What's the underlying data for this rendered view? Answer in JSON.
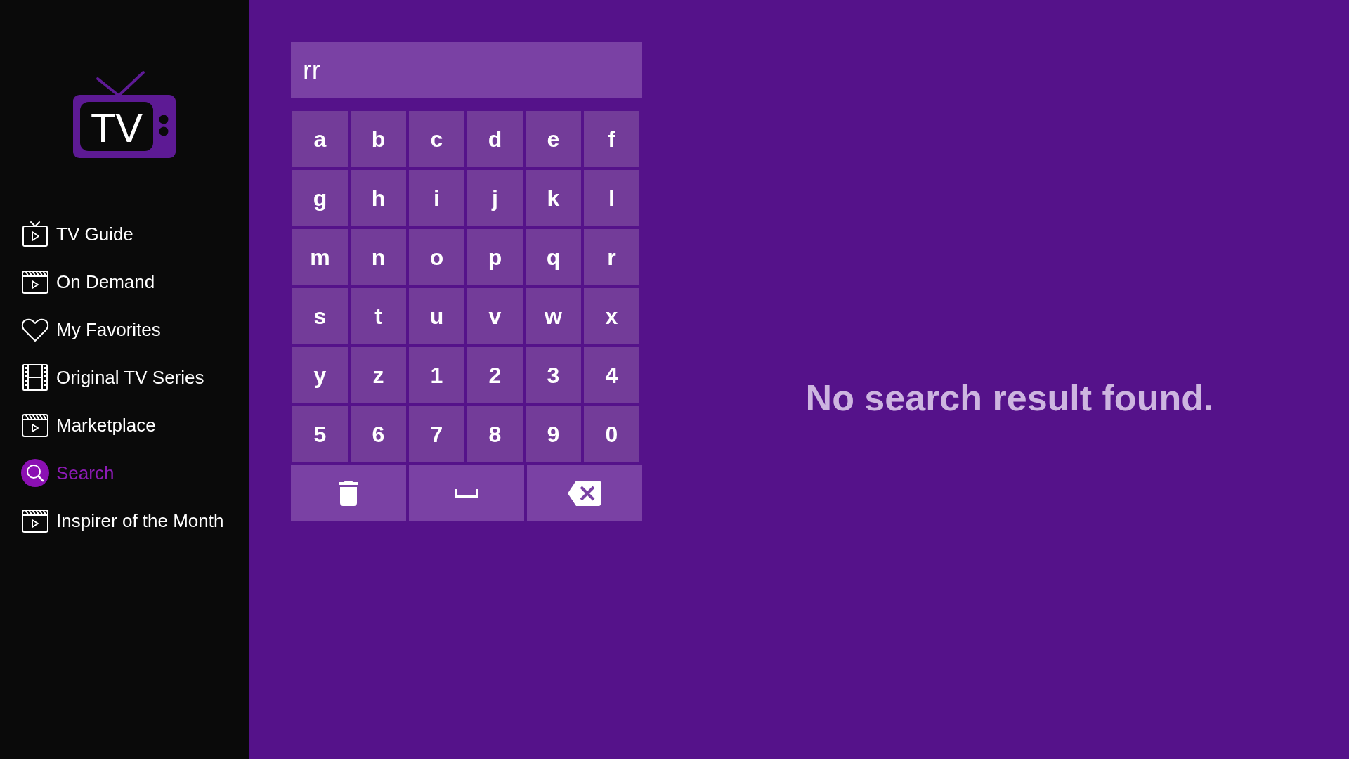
{
  "logo": {
    "text": "TV"
  },
  "sidebar": {
    "items": [
      {
        "label": "TV Guide",
        "kind": "tv",
        "selected": false
      },
      {
        "label": "On Demand",
        "kind": "clapper",
        "selected": false
      },
      {
        "label": "My Favorites",
        "kind": "heart",
        "selected": false
      },
      {
        "label": "Original TV Series",
        "kind": "film",
        "selected": false
      },
      {
        "label": "Marketplace",
        "kind": "clapper",
        "selected": false
      },
      {
        "label": "Search",
        "kind": "search",
        "selected": true
      },
      {
        "label": "Inspirer of the Month",
        "kind": "clapper",
        "selected": false
      }
    ]
  },
  "search": {
    "value": "rr"
  },
  "keyboard": {
    "rows": [
      [
        "a",
        "b",
        "c",
        "d",
        "e",
        "f"
      ],
      [
        "g",
        "h",
        "i",
        "j",
        "k",
        "l"
      ],
      [
        "m",
        "n",
        "o",
        "p",
        "q",
        "r"
      ],
      [
        "s",
        "t",
        "u",
        "v",
        "w",
        "x"
      ],
      [
        "y",
        "z",
        "1",
        "2",
        "3",
        "4"
      ],
      [
        "5",
        "6",
        "7",
        "8",
        "9",
        "0"
      ]
    ],
    "actions": [
      {
        "kind": "clear"
      },
      {
        "kind": "space"
      },
      {
        "kind": "backspace"
      }
    ]
  },
  "message": "No search result found."
}
